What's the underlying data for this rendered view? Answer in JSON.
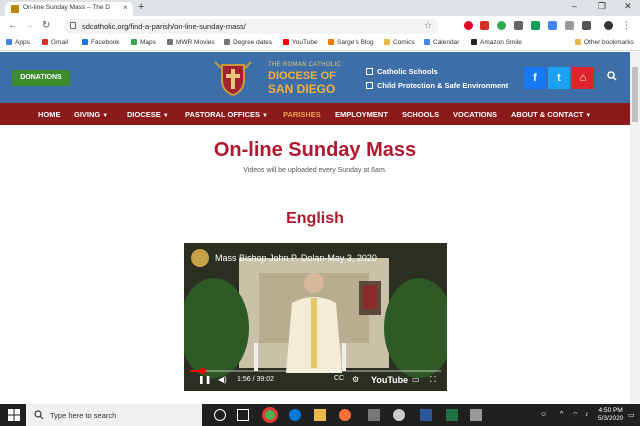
{
  "browser": {
    "tab_title": "On-line Sunday Mass – The D",
    "new_tab": "+",
    "url": "sdcatholic.org/find-a-parish/on-line-sunday-mass/",
    "bookmarks": [
      "Apps",
      "Gmail",
      "Facebook",
      "Maps",
      "MWR Movies",
      "Degree dates",
      "YouTube",
      "Sarge's Blog",
      "Comics",
      "Calendar",
      "Amazon Smile",
      "Other bookmarks"
    ]
  },
  "header": {
    "donate_label": "DONATIONS",
    "logo_top": "THE ROMAN CATHOLIC",
    "logo_line1": "DIOCESE OF",
    "logo_line2": "SAN DIEGO",
    "link_schools": "Catholic Schools",
    "link_protection": "Child Protection & Safe Environment",
    "colors": {
      "header_bg": "#3d6ea8",
      "accent": "#f3b23d",
      "donate": "#3c8c2e",
      "facebook": "#1877f2",
      "twitter": "#1da1f2",
      "lock": "#e0242e"
    }
  },
  "menu": [
    {
      "label": "HOME",
      "dropdown": false
    },
    {
      "label": "GIVING",
      "dropdown": true
    },
    {
      "label": "DIOCESE",
      "dropdown": true
    },
    {
      "label": "PASTORAL OFFICES",
      "dropdown": true
    },
    {
      "label": "PARISHES",
      "dropdown": false,
      "active": true
    },
    {
      "label": "EMPLOYMENT",
      "dropdown": false
    },
    {
      "label": "SCHOOLS",
      "dropdown": false
    },
    {
      "label": "VOCATIONS",
      "dropdown": false
    },
    {
      "label": "ABOUT & CONTACT",
      "dropdown": true
    }
  ],
  "content": {
    "title": "On-line Sunday Mass",
    "subtitle": "Videos will be uploaded every Sunday at 6am.",
    "section": "English"
  },
  "video": {
    "title": "Mass Bishop John P. Dolan-May 3, 2020",
    "time": "1:56 / 39:02",
    "progress": 0.05,
    "brand": "YouTube"
  },
  "taskbar": {
    "search_placeholder": "Type here to search",
    "time": "4:50 PM",
    "date": "5/3/2020"
  }
}
